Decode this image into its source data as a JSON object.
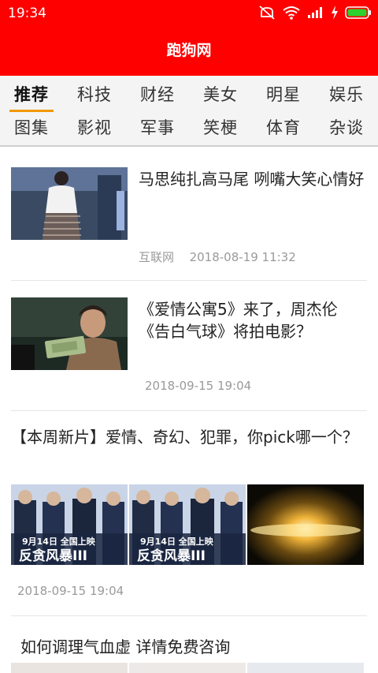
{
  "status_bar": {
    "time": "19:34",
    "icons": [
      "mute-icon",
      "wifi-icon",
      "signal-icon",
      "charging-icon",
      "battery-icon"
    ]
  },
  "app": {
    "title": "跑狗网"
  },
  "tabs": {
    "row1": [
      "推荐",
      "科技",
      "财经",
      "美女",
      "明星",
      "娱乐"
    ],
    "row2": [
      "图集",
      "影视",
      "军事",
      "笑梗",
      "体育",
      "杂谈"
    ],
    "active": "推荐"
  },
  "feed": {
    "items": [
      {
        "title": "马思纯扎高马尾 咧嘴大笑心情好",
        "source": "互联网",
        "time": "2018-08-19 11:32"
      },
      {
        "title": "《爱情公寓5》来了，周杰伦《告白气球》将拍电影？",
        "source": "",
        "time": "2018-09-15 19:04"
      },
      {
        "title": "【本周新片】爱情、奇幻、犯罪，你pick哪一个？",
        "time": "2018-09-15 19:04",
        "poster_text_1": "9月14日 全国上映",
        "poster_text_2": "反贪风暴III"
      },
      {
        "title": "如何调理气血虚 详情免费咨询"
      }
    ]
  },
  "colors": {
    "brand": "#ff0000",
    "tab_indicator": "#f39800",
    "meta": "#9a9a9a"
  }
}
